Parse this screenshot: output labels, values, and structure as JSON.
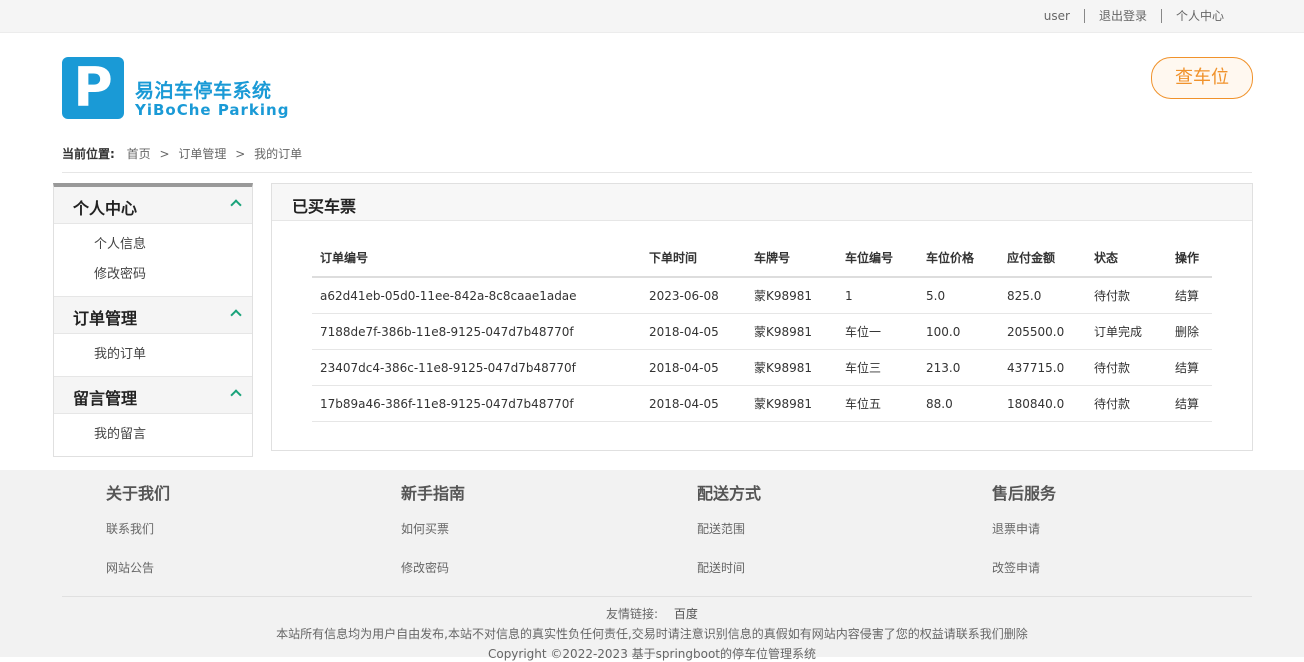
{
  "topbar": {
    "user": "user",
    "logout": "退出登录",
    "profile": "个人中心"
  },
  "header": {
    "logo_letter": "P",
    "brand_cn": "易泊车停车系统",
    "brand_en": "YiBoChe  Parking",
    "find_button": "查车位"
  },
  "breadcrumb": {
    "label": "当前位置:",
    "items": [
      "首页",
      "订单管理",
      "我的订单"
    ],
    "separator": ">"
  },
  "sidebar": {
    "groups": [
      {
        "title": "个人中心",
        "items": [
          "个人信息",
          "修改密码"
        ]
      },
      {
        "title": "订单管理",
        "items": [
          "我的订单"
        ]
      },
      {
        "title": "留言管理",
        "items": [
          "我的留言"
        ]
      }
    ]
  },
  "main": {
    "title": "已买车票",
    "columns": [
      "订单编号",
      "下单时间",
      "车牌号",
      "车位编号",
      "车位价格",
      "应付金额",
      "状态",
      "操作"
    ],
    "rows": [
      [
        "a62d41eb-05d0-11ee-842a-8c8caae1adae",
        "2023-06-08",
        "蒙K98981",
        "1",
        "5.0",
        "825.0",
        "待付款",
        "结算"
      ],
      [
        "7188de7f-386b-11e8-9125-047d7b48770f",
        "2018-04-05",
        "蒙K98981",
        "车位一",
        "100.0",
        "205500.0",
        "订单完成",
        "删除"
      ],
      [
        "23407dc4-386c-11e8-9125-047d7b48770f",
        "2018-04-05",
        "蒙K98981",
        "车位三",
        "213.0",
        "437715.0",
        "待付款",
        "结算"
      ],
      [
        "17b89a46-386f-11e8-9125-047d7b48770f",
        "2018-04-05",
        "蒙K98981",
        "车位五",
        "88.0",
        "180840.0",
        "待付款",
        "结算"
      ]
    ],
    "status_colors": {
      "待付款": "#d9262c",
      "订单完成": "#1d8a2e"
    }
  },
  "footer": {
    "columns": [
      {
        "title": "关于我们",
        "links": [
          "联系我们",
          "网站公告"
        ]
      },
      {
        "title": "新手指南",
        "links": [
          "如何买票",
          "修改密码"
        ]
      },
      {
        "title": "配送方式",
        "links": [
          "配送范围",
          "配送时间"
        ]
      },
      {
        "title": "售后服务",
        "links": [
          "退票申请",
          "改签申请"
        ]
      }
    ],
    "friend_label": "友情链接:",
    "friend_link": "百度",
    "notice": "本站所有信息均为用户自由发布,本站不对信息的真实性负任何责任,交易时请注意识别信息的真假如有网站内容侵害了您的权益请联系我们删除",
    "copyright": "Copyright ©2022-2023 基于springboot的停车位管理系统"
  },
  "colors": {
    "brand": "#1a9ad6",
    "accent_orange": "#f0922b",
    "chevron": "#1aa37a"
  }
}
